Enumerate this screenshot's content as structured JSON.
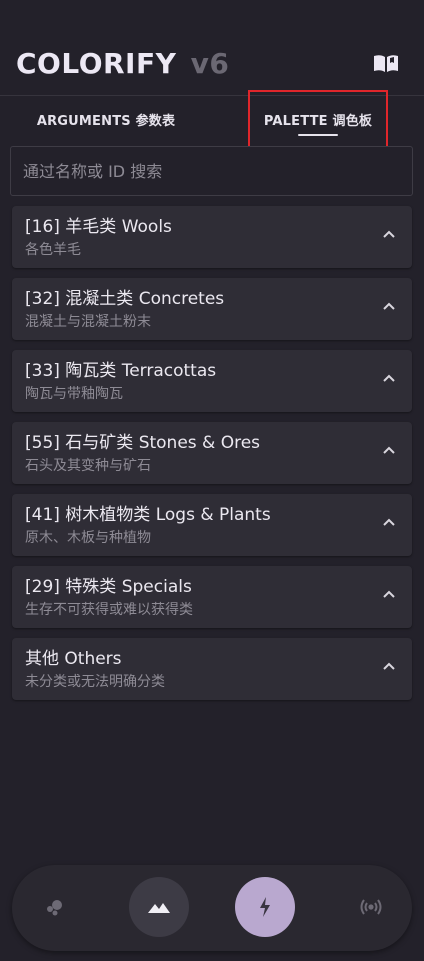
{
  "app": {
    "title": "COLORIFY",
    "version": "v6"
  },
  "header": {
    "help_icon": "book-open-icon"
  },
  "tabs": [
    {
      "label": "ARGUMENTS 参数表",
      "active": false
    },
    {
      "label": "PALETTE 调色板",
      "active": true
    }
  ],
  "search": {
    "placeholder": "通过名称或 ID 搜索",
    "value": ""
  },
  "categories": [
    {
      "title": "[16] 羊毛类 Wools",
      "subtitle": "各色羊毛",
      "icon": "chevron-up-icon"
    },
    {
      "title": "[32] 混凝土类 Concretes",
      "subtitle": "混凝土与混凝土粉末",
      "icon": "chevron-up-icon"
    },
    {
      "title": "[33] 陶瓦类 Terracottas",
      "subtitle": "陶瓦与带釉陶瓦",
      "icon": "chevron-up-icon"
    },
    {
      "title": "[55] 石与矿类 Stones & Ores",
      "subtitle": "石头及其变种与矿石",
      "icon": "chevron-up-icon"
    },
    {
      "title": "[41] 树木植物类 Logs & Plants",
      "subtitle": "原木、木板与种植物",
      "icon": "chevron-up-icon"
    },
    {
      "title": "[29] 特殊类 Specials",
      "subtitle": "生存不可获得或难以获得类",
      "icon": "chevron-up-icon"
    },
    {
      "title": "其他 Others",
      "subtitle": "未分类或无法明确分类",
      "icon": "chevron-up-icon"
    }
  ],
  "bottom_nav": [
    {
      "icon": "bubbles-icon",
      "active": false
    },
    {
      "icon": "mountain-icon",
      "active": false
    },
    {
      "icon": "bolt-icon",
      "active": true
    },
    {
      "icon": "broadcast-icon",
      "active": false
    }
  ],
  "colors": {
    "background": "#23212a",
    "card": "#2f2d36",
    "accent": "#b9a8cf",
    "highlight_box": "#e0262b"
  }
}
